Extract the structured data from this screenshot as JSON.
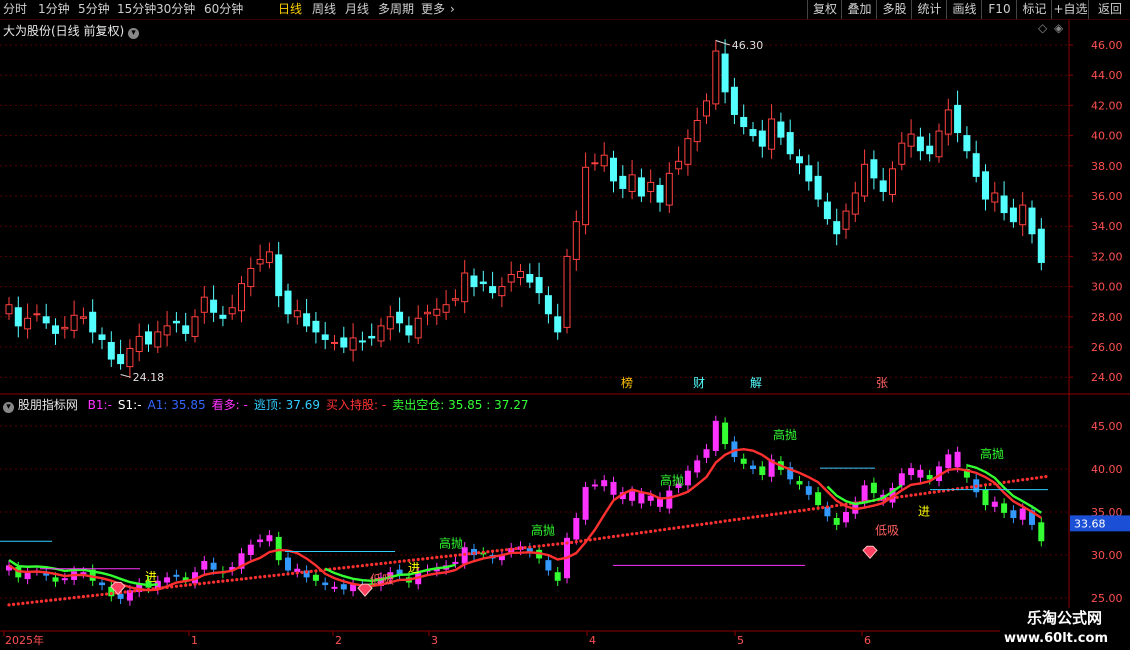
{
  "toolbar": {
    "periods": [
      "分时",
      "1分钟",
      "5分钟",
      "15分钟",
      "30分钟",
      "60分钟",
      "日线",
      "周线",
      "月线",
      "多周期",
      "更多"
    ],
    "active_period": "日线",
    "right_buttons": [
      "复权",
      "叠加",
      "多股",
      "统计",
      "画线",
      "F10",
      "标记",
      "+自选",
      "返回"
    ]
  },
  "main_panel": {
    "title": "大为股份(日线 前复权)",
    "high_label": "46.30",
    "low_label": "24.18",
    "event_markers": [
      "榜",
      "财",
      "解",
      "张"
    ],
    "y_ticks": [
      "46.00",
      "44.00",
      "42.00",
      "40.00",
      "38.00",
      "36.00",
      "34.00",
      "32.00",
      "30.00",
      "28.00",
      "26.00",
      "24.00"
    ]
  },
  "indicator_panel": {
    "name": "股朋指标网",
    "legend": [
      {
        "text": "B1:-",
        "color": "#ff33ff"
      },
      {
        "text": "S1:-",
        "color": "#ffffff"
      },
      {
        "text": "A1: 35.85",
        "color": "#3366ff"
      },
      {
        "text": "看多: -",
        "color": "#ff33ff"
      },
      {
        "text": "逃顶: 37.69",
        "color": "#33ccff"
      },
      {
        "text": "买入持股: -",
        "color": "#ff3333"
      },
      {
        "text": "卖出空仓: 35.85 : 37.27",
        "color": "#33ff33"
      }
    ],
    "y_ticks": [
      "45.00",
      "40.00",
      "35.00",
      "30.00",
      "25.00"
    ],
    "current_price": "33.68",
    "signal_labels": {
      "high_sell": "高抛",
      "low_buy": "低吸",
      "enter": "进"
    }
  },
  "time_axis": {
    "labels": [
      "2025年",
      "1",
      "2",
      "3",
      "4",
      "5",
      "6"
    ]
  },
  "watermark": {
    "line1": "乐淘公式网",
    "line2": "www.60lt.com"
  },
  "colors": {
    "up": "#ff4040",
    "down": "#54ffff",
    "grid": "#5a0000",
    "magenta": "#ff33ff",
    "green": "#33ff33",
    "red": "#ff3030",
    "blue": "#3399ff"
  }
}
